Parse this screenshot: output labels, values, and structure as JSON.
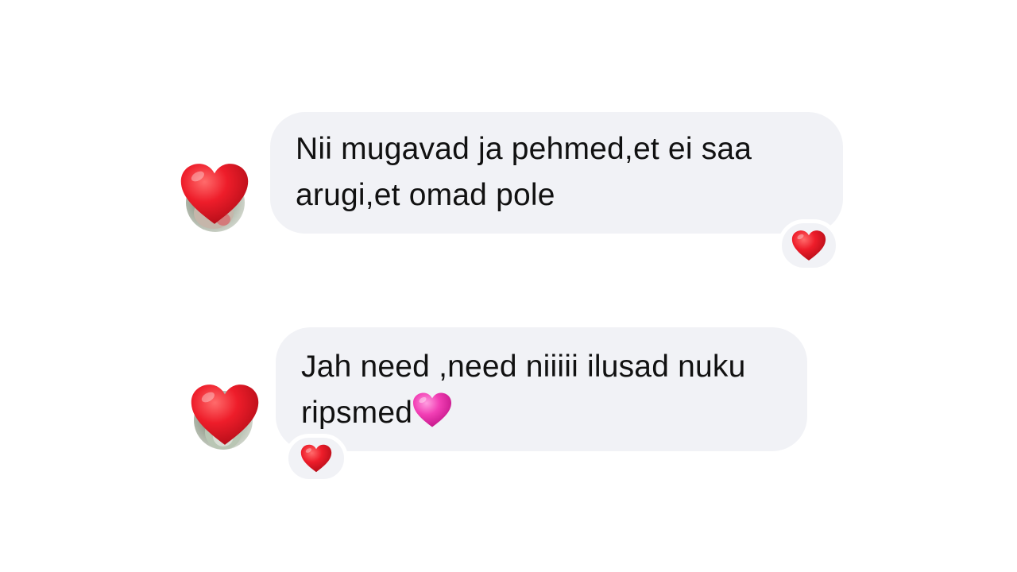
{
  "messages": [
    {
      "text": "Nii mugavad ja pehmed,et ei saa\narugi,et omad pole",
      "avatar_overlay_icon": "red-heart-icon",
      "reaction": "red-heart-icon"
    },
    {
      "text": "Jah need ,need niiiii ilusad nuku\nripsmed",
      "trailing_emoji": "pink-heart-icon",
      "avatar_overlay_icon": "red-heart-icon",
      "reaction": "red-heart-icon"
    }
  ],
  "colors": {
    "bubble": "#f1f2f6",
    "text": "#111111",
    "red_heart": "#e8192c",
    "pink_heart": "#f23fb5",
    "background": "#ffffff"
  }
}
